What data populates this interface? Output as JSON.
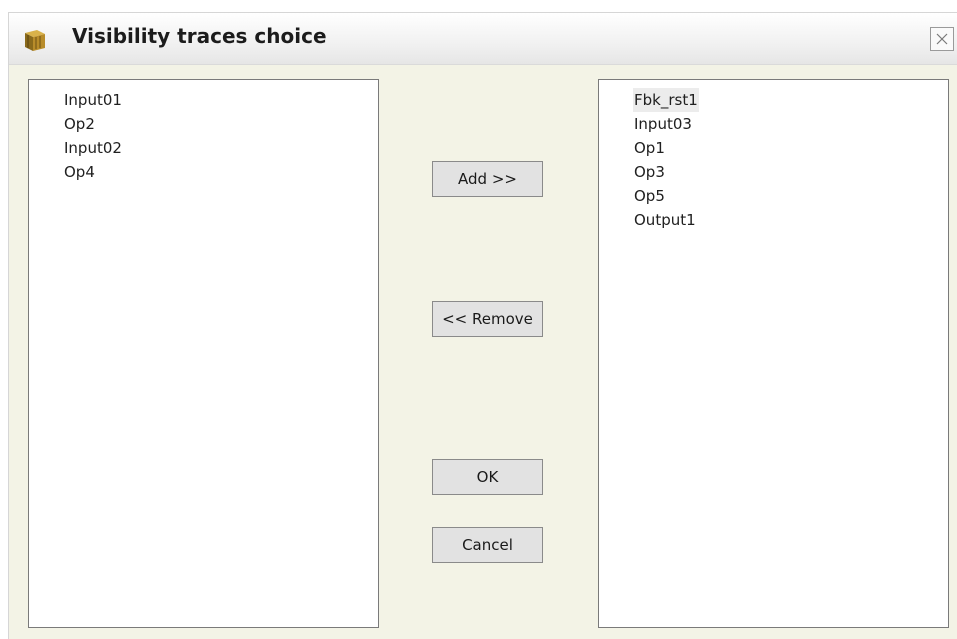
{
  "window": {
    "title": "Visibility traces choice",
    "app_icon": "cube-icon",
    "close_icon": "close-icon"
  },
  "available_list": {
    "items": [
      "Input01",
      "Op2",
      "Input02",
      "Op4"
    ]
  },
  "selected_list": {
    "items": [
      "Fbk_rst1",
      "Input03",
      "Op1",
      "Op3",
      "Op5",
      "Output1"
    ],
    "highlighted_item": "Fbk_rst1"
  },
  "buttons": {
    "add_label": "Add >>",
    "remove_label": "<< Remove",
    "ok_label": "OK",
    "cancel_label": "Cancel"
  },
  "colors": {
    "dialog_background": "#f3f3e6",
    "list_background": "#ffffff",
    "button_background": "#e2e2e2",
    "highlight": "#ececec"
  }
}
